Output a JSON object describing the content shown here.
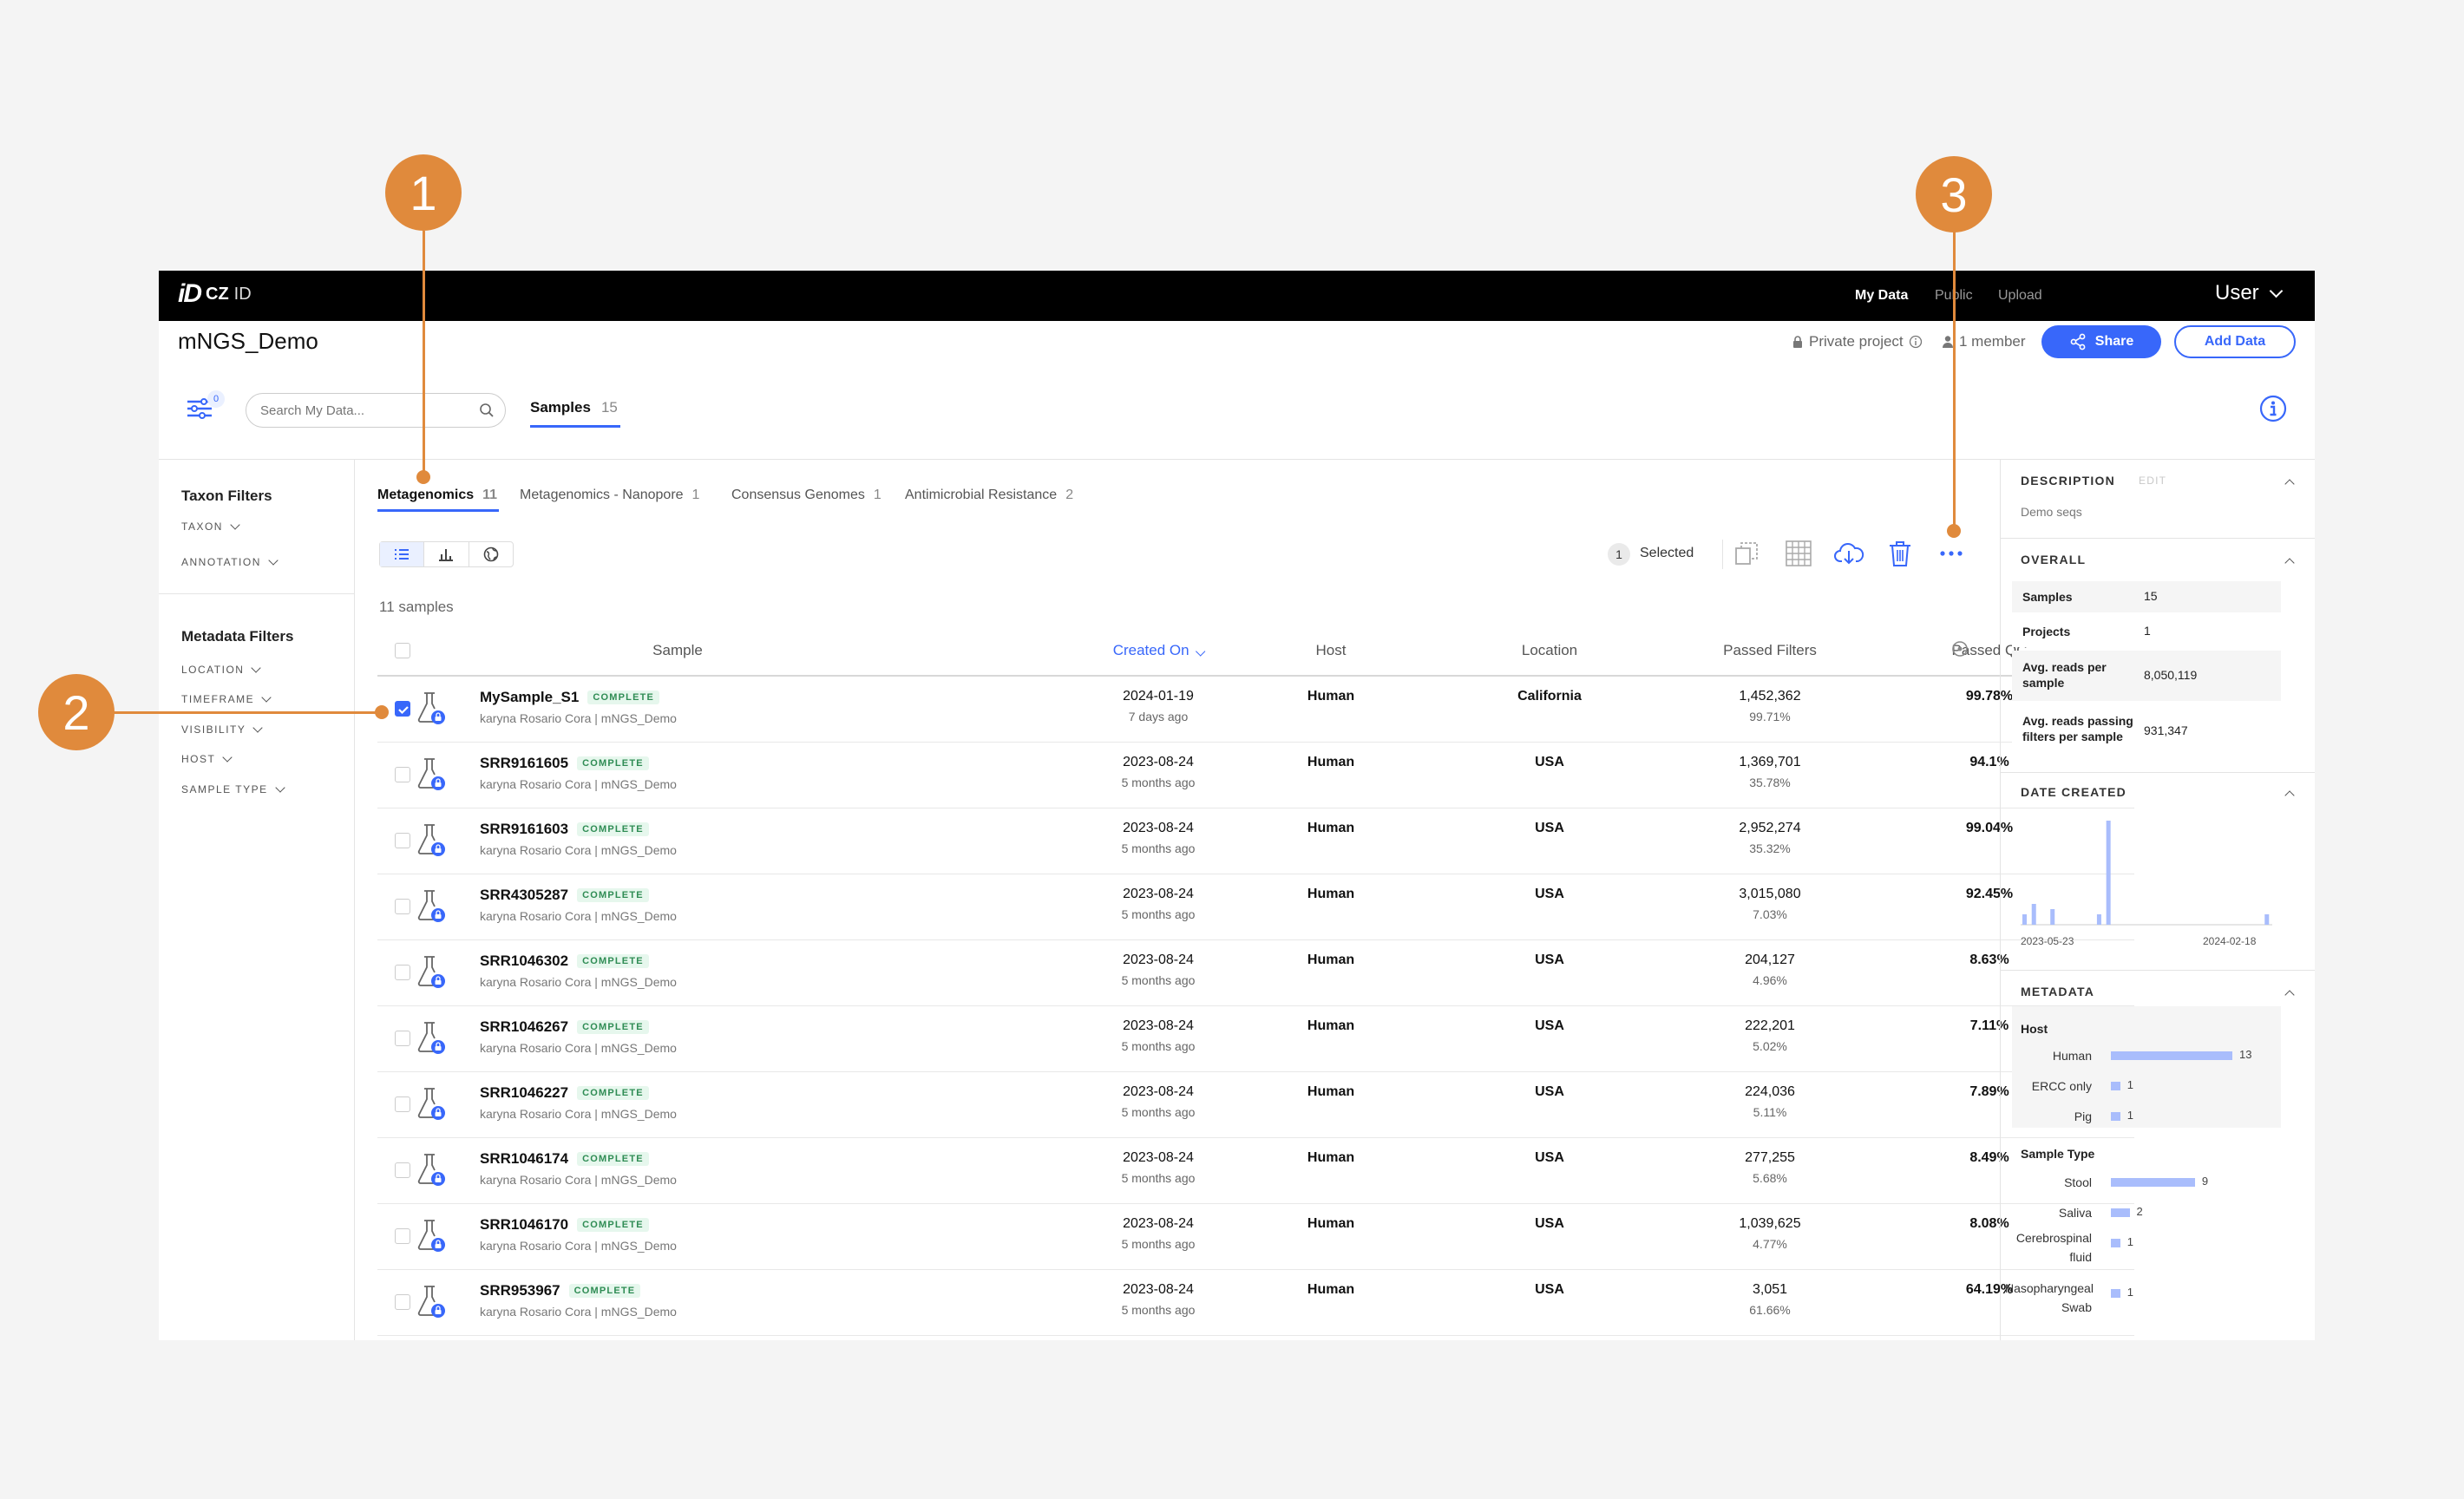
{
  "topbar": {
    "logo_mark": "iD",
    "logo_cz": "CZ",
    "logo_id": "ID",
    "nav_my_data": "My Data",
    "nav_public": "Public",
    "nav_upload": "Upload",
    "user": "User"
  },
  "header": {
    "project_title": "mNGS_Demo",
    "privacy": "Private project",
    "members": "1 member",
    "share": "Share",
    "add_data": "Add Data"
  },
  "toolbar": {
    "filter_count": "0",
    "search_placeholder": "Search My Data...",
    "samples_tab": "Samples",
    "samples_count": "15"
  },
  "filters": {
    "taxon_heading": "Taxon Filters",
    "taxon_items": [
      "TAXON",
      "ANNOTATION"
    ],
    "metadata_heading": "Metadata Filters",
    "metadata_items": [
      "LOCATION",
      "TIMEFRAME",
      "VISIBILITY",
      "HOST",
      "SAMPLE TYPE"
    ]
  },
  "workflow_tabs": [
    {
      "label": "Metagenomics",
      "count": "11"
    },
    {
      "label": "Metagenomics - Nanopore",
      "count": "1"
    },
    {
      "label": "Consensus Genomes",
      "count": "1"
    },
    {
      "label": "Antimicrobial Resistance",
      "count": "2"
    }
  ],
  "selection": {
    "count": "1",
    "label": "Selected"
  },
  "sample_count_text": "11 samples",
  "columns": [
    "Sample",
    "Created On",
    "Host",
    "Location",
    "Passed Filters",
    "Passed QC"
  ],
  "status_label": "COMPLETE",
  "rows": [
    {
      "name": "MySample_S1",
      "user": "karyna Rosario Cora | mNGS_Demo",
      "date": "2024-01-19",
      "ago": "7 days ago",
      "host": "Human",
      "location": "California",
      "filters": "1,452,362",
      "filters_pct": "99.71%",
      "qc": "99.78%",
      "checked": true
    },
    {
      "name": "SRR9161605",
      "user": "karyna Rosario Cora | mNGS_Demo",
      "date": "2023-08-24",
      "ago": "5 months ago",
      "host": "Human",
      "location": "USA",
      "filters": "1,369,701",
      "filters_pct": "35.78%",
      "qc": "94.1%",
      "checked": false
    },
    {
      "name": "SRR9161603",
      "user": "karyna Rosario Cora | mNGS_Demo",
      "date": "2023-08-24",
      "ago": "5 months ago",
      "host": "Human",
      "location": "USA",
      "filters": "2,952,274",
      "filters_pct": "35.32%",
      "qc": "99.04%",
      "checked": false
    },
    {
      "name": "SRR4305287",
      "user": "karyna Rosario Cora | mNGS_Demo",
      "date": "2023-08-24",
      "ago": "5 months ago",
      "host": "Human",
      "location": "USA",
      "filters": "3,015,080",
      "filters_pct": "7.03%",
      "qc": "92.45%",
      "checked": false
    },
    {
      "name": "SRR1046302",
      "user": "karyna Rosario Cora | mNGS_Demo",
      "date": "2023-08-24",
      "ago": "5 months ago",
      "host": "Human",
      "location": "USA",
      "filters": "204,127",
      "filters_pct": "4.96%",
      "qc": "8.63%",
      "checked": false
    },
    {
      "name": "SRR1046267",
      "user": "karyna Rosario Cora | mNGS_Demo",
      "date": "2023-08-24",
      "ago": "5 months ago",
      "host": "Human",
      "location": "USA",
      "filters": "222,201",
      "filters_pct": "5.02%",
      "qc": "7.11%",
      "checked": false
    },
    {
      "name": "SRR1046227",
      "user": "karyna Rosario Cora | mNGS_Demo",
      "date": "2023-08-24",
      "ago": "5 months ago",
      "host": "Human",
      "location": "USA",
      "filters": "224,036",
      "filters_pct": "5.11%",
      "qc": "7.89%",
      "checked": false
    },
    {
      "name": "SRR1046174",
      "user": "karyna Rosario Cora | mNGS_Demo",
      "date": "2023-08-24",
      "ago": "5 months ago",
      "host": "Human",
      "location": "USA",
      "filters": "277,255",
      "filters_pct": "5.68%",
      "qc": "8.49%",
      "checked": false
    },
    {
      "name": "SRR1046170",
      "user": "karyna Rosario Cora | mNGS_Demo",
      "date": "2023-08-24",
      "ago": "5 months ago",
      "host": "Human",
      "location": "USA",
      "filters": "1,039,625",
      "filters_pct": "4.77%",
      "qc": "8.08%",
      "checked": false
    },
    {
      "name": "SRR953967",
      "user": "karyna Rosario Cora | mNGS_Demo",
      "date": "2023-08-24",
      "ago": "5 months ago",
      "host": "Human",
      "location": "USA",
      "filters": "3,051",
      "filters_pct": "61.66%",
      "qc": "64.19%",
      "checked": false
    }
  ],
  "sidebar": {
    "description_heading": "DESCRIPTION",
    "edit": "EDIT",
    "description": "Demo seqs",
    "overall_heading": "OVERALL",
    "overall": [
      {
        "k": "Samples",
        "v": "15"
      },
      {
        "k": "Projects",
        "v": "1"
      },
      {
        "k": "Avg. reads per sample",
        "v": "8,050,119"
      },
      {
        "k": "Avg. reads passing filters per sample",
        "v": "931,347"
      }
    ],
    "date_heading": "DATE CREATED",
    "date_start": "2023-05-23",
    "date_end": "2024-02-18",
    "date_histogram": [
      2,
      4,
      0,
      3,
      0,
      0,
      0,
      0,
      2,
      20,
      0,
      0,
      0,
      0,
      0,
      0,
      0,
      0,
      0,
      0,
      0,
      0,
      0,
      0,
      0,
      0,
      2
    ],
    "metadata_heading": "METADATA",
    "host_label": "Host",
    "host": [
      {
        "k": "Human",
        "v": 13
      },
      {
        "k": "ERCC only",
        "v": 1
      },
      {
        "k": "Pig",
        "v": 1
      }
    ],
    "sample_type_label": "Sample Type",
    "sample_type": [
      {
        "k": "Stool",
        "v": 9
      },
      {
        "k": "Saliva",
        "v": 2
      },
      {
        "k": "Cerebrospinal fluid",
        "v": 1
      },
      {
        "k": "Nasopharyngeal Swab",
        "v": 1
      }
    ]
  },
  "callouts": [
    "1",
    "2",
    "3"
  ],
  "colors": {
    "accent": "#3867fa",
    "callout": "#e08a3c",
    "complete_bg": "#e6f7ed",
    "complete_fg": "#2f8c54"
  }
}
